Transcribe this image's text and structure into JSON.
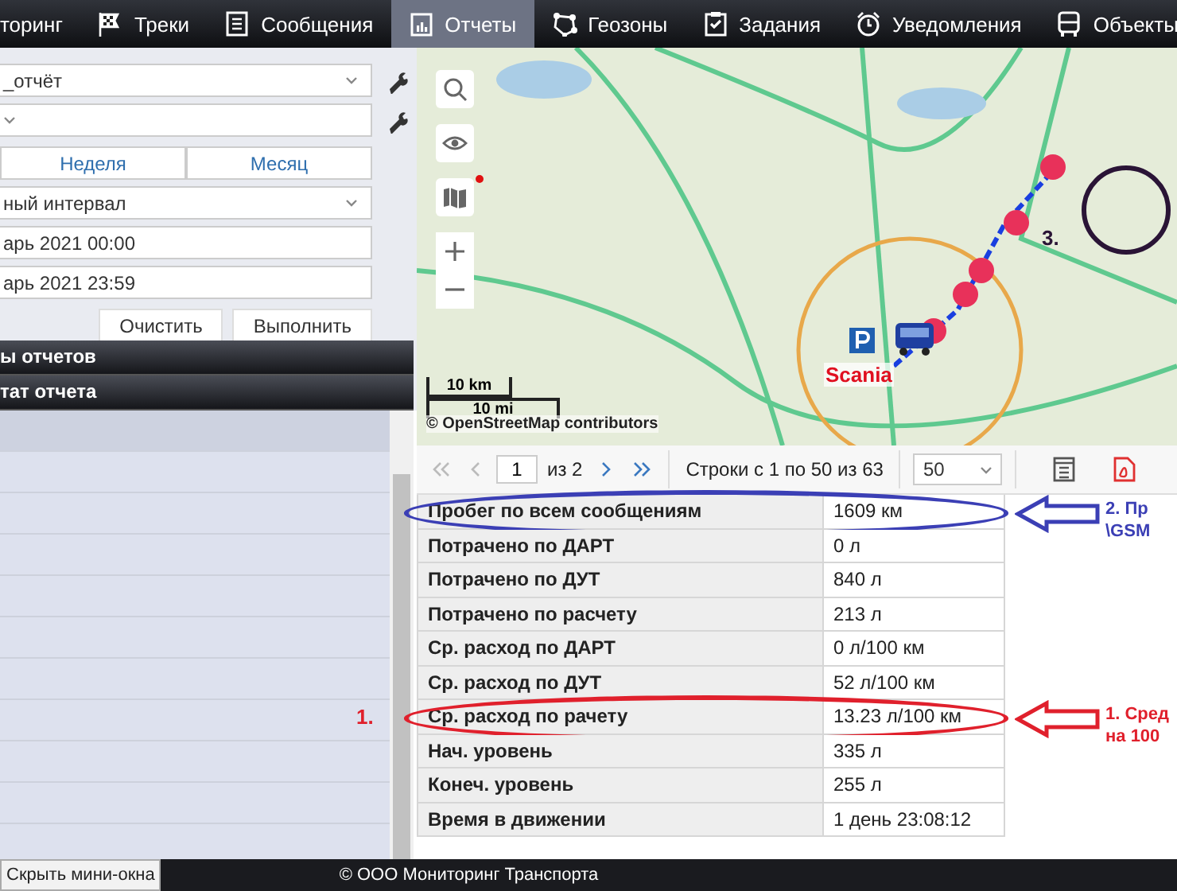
{
  "nav": {
    "items": [
      {
        "label": "торинг",
        "selected": false
      },
      {
        "label": "Треки",
        "selected": false
      },
      {
        "label": "Сообщения",
        "selected": false
      },
      {
        "label": "Отчеты",
        "selected": true
      },
      {
        "label": "Геозоны",
        "selected": false
      },
      {
        "label": "Задания",
        "selected": false
      },
      {
        "label": "Уведомления",
        "selected": false
      },
      {
        "label": "Объекты",
        "selected": false
      }
    ]
  },
  "report_form": {
    "template": {
      "value": "_отчёт"
    },
    "object": {
      "kind": "select"
    },
    "period_buttons": [
      {
        "label": "Неделя",
        "selected": false
      },
      {
        "label": "Месяц",
        "selected": false
      }
    ],
    "interval": {
      "value": "ный интервал"
    },
    "from": {
      "value": "арь 2021 00:00"
    },
    "to": {
      "value": "арь 2021 23:59"
    },
    "buttons": [
      "Очистить",
      "Выполнить"
    ]
  },
  "panels": [
    {
      "title": "ы отчетов"
    },
    {
      "title": "тат отчета"
    }
  ],
  "map": {
    "vehicle_label": "Scania",
    "scale": [
      "10 km",
      "10 mi"
    ],
    "attribution": "© OpenStreetMap contributors",
    "marker": {
      "label": "3.",
      "color": "#2a1436"
    }
  },
  "pager": {
    "page": "1",
    "of": "из 2",
    "rows_info": "Строки с 1 по 50 из 63",
    "page_size": "50"
  },
  "table": {
    "rows": [
      {
        "name": "Пробег по всем сообщениям",
        "value": "1609 км",
        "callout": {
          "color": "#3b3fb5",
          "lines": [
            "2. Пр",
            "\\GSM"
          ]
        }
      },
      {
        "name": "Потрачено по ДАРТ",
        "value": "0 л"
      },
      {
        "name": "Потрачено по ДУТ",
        "value": "840 л"
      },
      {
        "name": "Потрачено по расчету",
        "value": "213 л"
      },
      {
        "name": "Ср. расход по ДАРТ",
        "value": "0 л/100 км"
      },
      {
        "name": "Ср. расход по ДУТ",
        "value": "52 л/100 км"
      },
      {
        "name": "Ср. расход по рачету",
        "value": "13.23 л/100 км",
        "callout": {
          "color": "#e0202c",
          "marker": "1.",
          "lines": [
            "1. Сред",
            "на 100"
          ]
        }
      },
      {
        "name": "Нач. уровень",
        "value": "335 л"
      },
      {
        "name": "Конеч. уровень",
        "value": "255 л"
      },
      {
        "name": "Время в движении",
        "value": "1 день 23:08:12"
      }
    ]
  },
  "footer": {
    "hide_button": "Скрыть мини-окна",
    "copyright": "© ООО Мониторинг Транспорта"
  }
}
